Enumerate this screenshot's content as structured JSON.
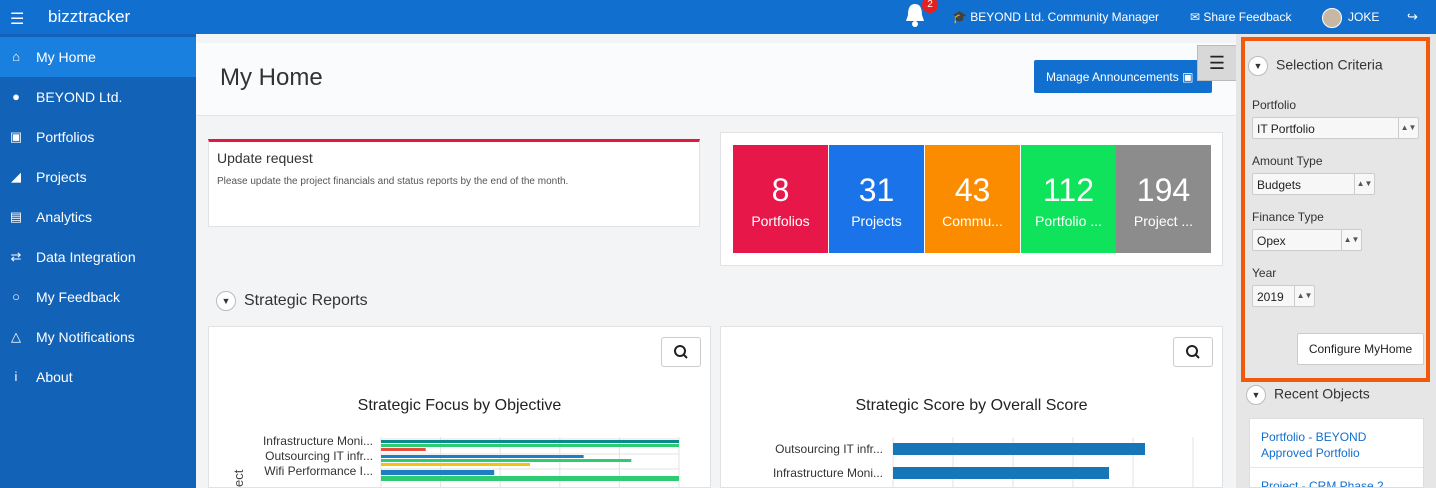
{
  "topbar": {
    "brand": "bizztracker",
    "notification_count": "2",
    "community": "BEYOND Ltd. Community Manager",
    "feedback": "Share Feedback",
    "user": "JOKE"
  },
  "sidebar": {
    "items": [
      {
        "label": "My Home",
        "icon": "home-icon"
      },
      {
        "label": "BEYOND Ltd.",
        "icon": "users-icon"
      },
      {
        "label": "Portfolios",
        "icon": "briefcase-icon"
      },
      {
        "label": "Projects",
        "icon": "area-chart-icon"
      },
      {
        "label": "Analytics",
        "icon": "bar-chart-icon"
      },
      {
        "label": "Data Integration",
        "icon": "exchange-icon"
      },
      {
        "label": "My Feedback",
        "icon": "comments-icon"
      },
      {
        "label": "My Notifications",
        "icon": "bell-icon"
      },
      {
        "label": "About",
        "icon": "info-icon"
      }
    ]
  },
  "page": {
    "title": "My Home",
    "manage_label": "Manage Announcements"
  },
  "announcement": {
    "title": "Update request",
    "text": "Please update the project financials and status reports by the end of the month."
  },
  "tiles": [
    {
      "value": "8",
      "label": "Portfolios",
      "color": "#e8174a"
    },
    {
      "value": "31",
      "label": "Projects",
      "color": "#1a73e8"
    },
    {
      "value": "43",
      "label": "Commu...",
      "color": "#fb8c00"
    },
    {
      "value": "112",
      "label": "Portfolio ...",
      "color": "#0fe35c"
    },
    {
      "value": "194",
      "label": "Project ...",
      "color": "#8c8c8c"
    }
  ],
  "strategic": {
    "section_title": "Strategic Reports"
  },
  "chart_data": [
    {
      "type": "bar",
      "title": "Strategic Focus by Objective",
      "ylabel": "ect",
      "categories": [
        "Infrastructure Moni...",
        "Outsourcing IT infr...",
        "Wifi Performance I..."
      ],
      "series": [
        {
          "color": "#0a8a8a",
          "values": [
            100,
            0,
            0
          ]
        },
        {
          "color": "#1d7ec4",
          "values": [
            0,
            68,
            38
          ]
        },
        {
          "color": "#2ecc71",
          "values": [
            100,
            84,
            100
          ]
        },
        {
          "color": "#e74c3c",
          "values": [
            15,
            0,
            0
          ]
        },
        {
          "color": "#f1c40f",
          "values": [
            0,
            50,
            0
          ]
        }
      ],
      "xlim": [
        0,
        100
      ]
    },
    {
      "type": "bar",
      "title": "Strategic Score by Overall Score",
      "categories": [
        "Outsourcing IT infr...",
        "Infrastructure Moni..."
      ],
      "values": [
        84,
        72
      ],
      "color": "#1577b8",
      "xlim": [
        0,
        100
      ]
    }
  ],
  "selection": {
    "title": "Selection Criteria",
    "portfolio_label": "Portfolio",
    "portfolio_value": "IT Portfolio",
    "amount_label": "Amount Type",
    "amount_value": "Budgets",
    "finance_label": "Finance Type",
    "finance_value": "Opex",
    "year_label": "Year",
    "year_value": "2019",
    "configure_label": "Configure MyHome"
  },
  "recent": {
    "title": "Recent Objects",
    "items": [
      "Portfolio - BEYOND Approved Portfolio",
      "Project - CRM Phase 2"
    ]
  }
}
